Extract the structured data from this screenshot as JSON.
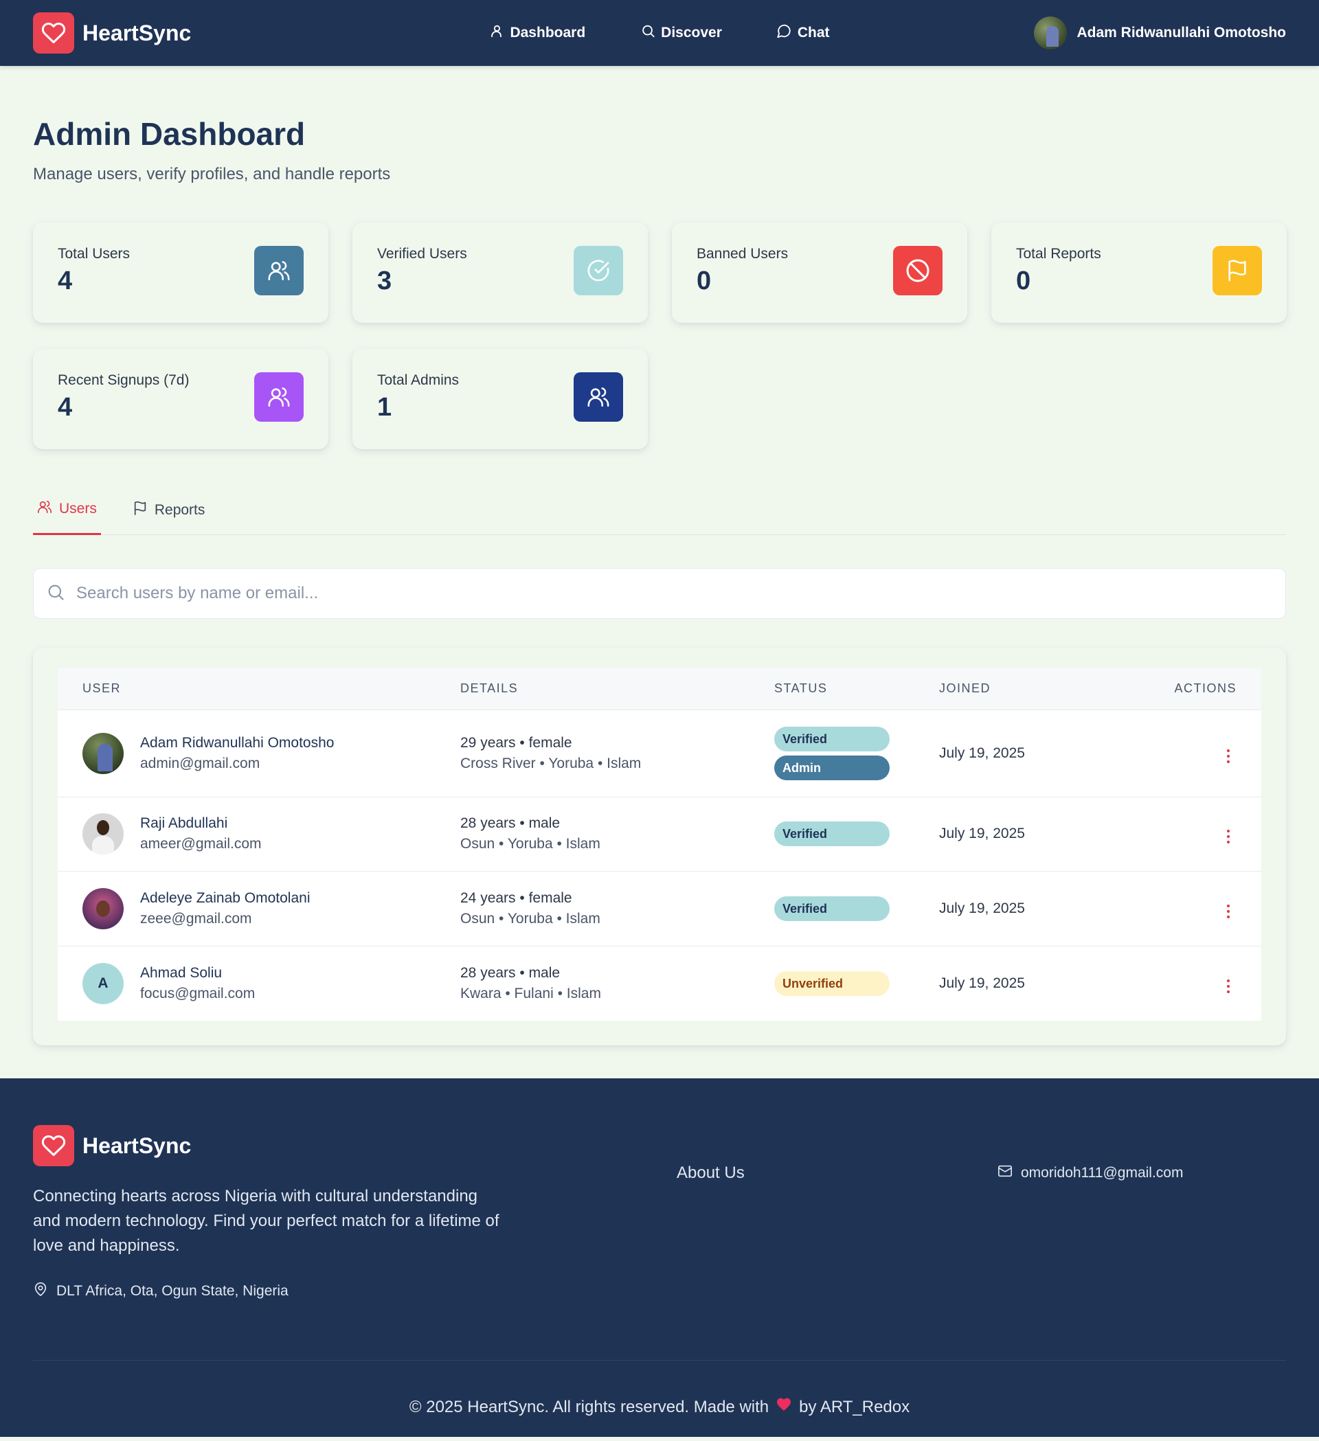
{
  "colors": {
    "header_bg": "#1f3355",
    "page_bg": "#f0f8ee",
    "brand_red": "#ea4251",
    "accent_red": "#e03546"
  },
  "header": {
    "brand": "HeartSync",
    "nav": [
      {
        "label": "Dashboard",
        "icon": "user-icon"
      },
      {
        "label": "Discover",
        "icon": "search-icon"
      },
      {
        "label": "Chat",
        "icon": "message-icon"
      }
    ],
    "user_name": "Adam Ridwanullahi Omotosho"
  },
  "page": {
    "title": "Admin Dashboard",
    "subtitle": "Manage users, verify profiles, and handle reports"
  },
  "stats": [
    {
      "label": "Total Users",
      "value": "4",
      "icon": "users-icon",
      "color": "#457b9d"
    },
    {
      "label": "Verified Users",
      "value": "3",
      "icon": "check-circle-icon",
      "color": "#a8dadc"
    },
    {
      "label": "Banned Users",
      "value": "0",
      "icon": "ban-icon",
      "color": "#ef4444"
    },
    {
      "label": "Total Reports",
      "value": "0",
      "icon": "flag-icon",
      "color": "#fbbf24"
    },
    {
      "label": "Recent Signups (7d)",
      "value": "4",
      "icon": "users-icon",
      "color": "#a855f7"
    },
    {
      "label": "Total Admins",
      "value": "1",
      "icon": "users-icon",
      "color": "#1e3a8a"
    }
  ],
  "tabs": [
    {
      "label": "Users",
      "icon": "users-icon",
      "active": true
    },
    {
      "label": "Reports",
      "icon": "flag-icon",
      "active": false
    }
  ],
  "search": {
    "placeholder": "Search users by name or email...",
    "value": ""
  },
  "table": {
    "columns": [
      "User",
      "Details",
      "Status",
      "Joined",
      "Actions"
    ],
    "rows": [
      {
        "name": "Adam Ridwanullahi Omotosho",
        "email": "admin@gmail.com",
        "details1": "29 years • female",
        "details2": "Cross River • Yoruba • Islam",
        "badges": [
          "Verified",
          "Admin"
        ],
        "joined": "July 19, 2025"
      },
      {
        "name": "Raji Abdullahi",
        "email": "ameer@gmail.com",
        "details1": "28 years • male",
        "details2": "Osun • Yoruba • Islam",
        "badges": [
          "Verified"
        ],
        "joined": "July 19, 2025"
      },
      {
        "name": "Adeleye Zainab Omotolani",
        "email": "zeee@gmail.com",
        "details1": "24 years • female",
        "details2": "Osun • Yoruba • Islam",
        "badges": [
          "Verified"
        ],
        "joined": "July 19, 2025"
      },
      {
        "name": "Ahmad Soliu",
        "email": "focus@gmail.com",
        "initial": "A",
        "details1": "28 years • male",
        "details2": "Kwara • Fulani • Islam",
        "badges": [
          "Unverified"
        ],
        "joined": "July 19, 2025"
      }
    ]
  },
  "footer": {
    "brand": "HeartSync",
    "description": "Connecting hearts across Nigeria with cultural understanding and modern technology. Find your perfect match for a lifetime of love and happiness.",
    "location": "DLT Africa, Ota, Ogun State, Nigeria",
    "about_link": "About Us",
    "email": "omoridoh111@gmail.com",
    "copyright_prefix": "© 2025 HeartSync. All rights reserved. Made with",
    "copyright_suffix": "by ART_Redox"
  }
}
